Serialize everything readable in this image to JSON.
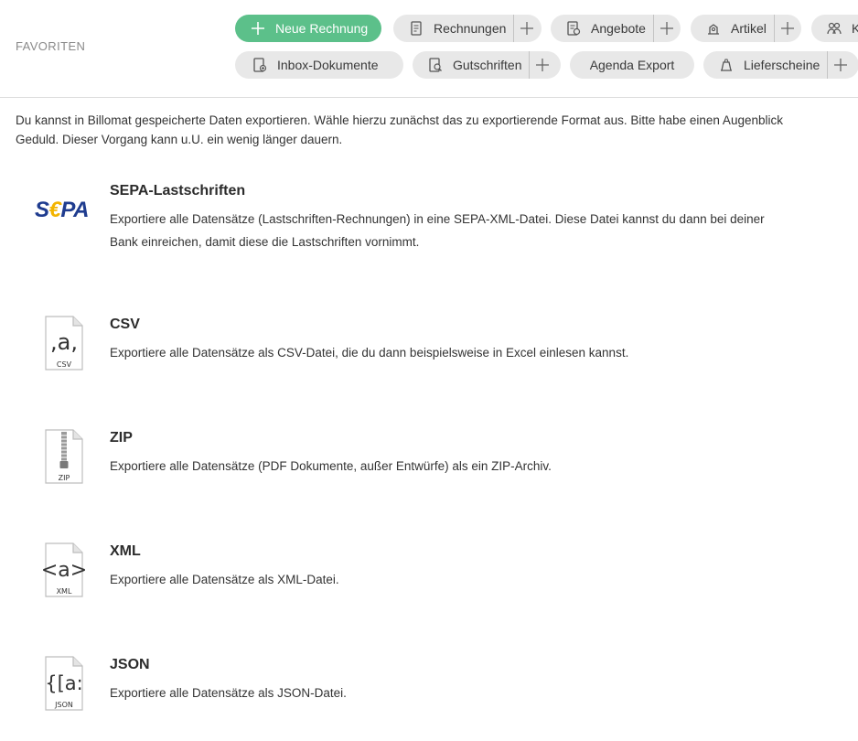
{
  "favorites": {
    "label": "FAVORITEN",
    "row1": [
      {
        "label": "Neue Rechnung",
        "icon": "plus-icon",
        "has_plus": false,
        "primary": true
      },
      {
        "label": "Rechnungen",
        "icon": "invoice-icon",
        "has_plus": true
      },
      {
        "label": "Angebote",
        "icon": "offer-icon",
        "has_plus": true
      },
      {
        "label": "Artikel",
        "icon": "article-icon",
        "has_plus": true
      },
      {
        "label": "K",
        "icon": "customers-icon",
        "has_plus": false
      }
    ],
    "row2": [
      {
        "label": "Inbox-Dokumente",
        "icon": "inbox-icon",
        "has_plus": false
      },
      {
        "label": "Gutschriften",
        "icon": "credit-note-icon",
        "has_plus": true
      },
      {
        "label": "Agenda Export",
        "icon": "",
        "has_plus": false
      },
      {
        "label": "Lieferscheine",
        "icon": "delivery-note-icon",
        "has_plus": true
      }
    ]
  },
  "intro": "Du kannst in Billomat gespeicherte Daten exportieren. Wähle hierzu zunächst das zu exportierende Format aus. Bitte habe einen Augenblick Geduld. Dieser Vorgang kann u.U. ein wenig länger dauern.",
  "exports": [
    {
      "title": "SEPA-Lastschriften",
      "description": "Exportiere alle Datensätze (Lastschriften-Rechnungen) in eine SEPA-XML-Datei. Diese Datei kannst du dann bei deiner Bank einreichen, damit diese die Lastschriften vornimmt.",
      "icon": "sepa-logo-icon",
      "logo_text_pre": "S",
      "logo_text_euro": "€",
      "logo_text_post": "PA"
    },
    {
      "title": "CSV",
      "description": "Exportiere alle Datensätze als CSV-Datei, die du dann beispielsweise in Excel einlesen kannst.",
      "icon": "csv-file-icon",
      "glyph": ",a,",
      "ext": "CSV"
    },
    {
      "title": "ZIP",
      "description": "Exportiere alle Datensätze (PDF Dokumente, außer Entwürfe) als ein ZIP-Archiv.",
      "icon": "zip-file-icon",
      "glyph": "",
      "ext": "ZIP"
    },
    {
      "title": "XML",
      "description": "Exportiere alle Datensätze als XML-Datei.",
      "icon": "xml-file-icon",
      "glyph": "<a>",
      "ext": "XML"
    },
    {
      "title": "JSON",
      "description": "Exportiere alle Datensätze als JSON-Datei.",
      "icon": "json-file-icon",
      "glyph": "{[a:",
      "ext": "JSON"
    }
  ],
  "colors": {
    "primary_green": "#5cc08a",
    "pill_gray": "#e8e8e8",
    "sepa_blue": "#1f3c8f",
    "sepa_yellow": "#f3b400"
  }
}
